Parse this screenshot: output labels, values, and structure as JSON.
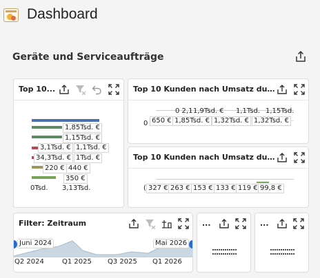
{
  "header": {
    "title": "Dashboard",
    "icon": "dashboard-app-icon"
  },
  "section": {
    "title": "Geräte und Serviceaufträge"
  },
  "colors": {
    "accent": "#333333",
    "bar_blue": "#4a6fb5",
    "bar_green": "#5c8a63",
    "bar_red": "#b04a55",
    "bar_olive": "#a0945a",
    "bar_lightgreen": "#7aa35c",
    "area_fill": "#c8d7e2"
  },
  "cards": {
    "top10_small": {
      "title": "Top 10...",
      "labels": [
        "1,85Tsd. €",
        "1,15Tsd. €",
        "3,1Tsd. €",
        "1,1Tsd. €",
        "34,3Tsd. €",
        "1Tsd. €",
        "220 €",
        "440 €",
        "350 €"
      ],
      "axis": [
        "0Tsd.",
        "3,13Tsd."
      ]
    },
    "kunden_umsatz_1": {
      "title": "Top 10 Kunden nach Umsatz durc...",
      "top_labels": [
        "0 2,1",
        "1,9Tsd. €",
        "1,1Tsd.",
        "1,15Tsd."
      ],
      "labels": [
        "650 €",
        "1,85Tsd. €",
        "1,32Tsd. €",
        "1,32Tsd. €"
      ],
      "lead": "0"
    },
    "kunden_umsatz_2": {
      "title": "Top 10 Kunden nach Umsatz durc...",
      "labels": [
        "327 €",
        "263 €",
        "153 €",
        "133 €",
        "119 €",
        "99,8 €"
      ],
      "lead": "("
    },
    "filter_zeitraum": {
      "title": "Filter: Zeitraum",
      "start_label": "Juni 2024",
      "end_label": "Mai 2026",
      "axis": [
        "Q2 2024",
        "Q1 2025",
        "Q3 2025",
        "Q1 2026"
      ]
    },
    "mini1": {
      "title": "..."
    },
    "mini2": {
      "title": "..."
    }
  }
}
